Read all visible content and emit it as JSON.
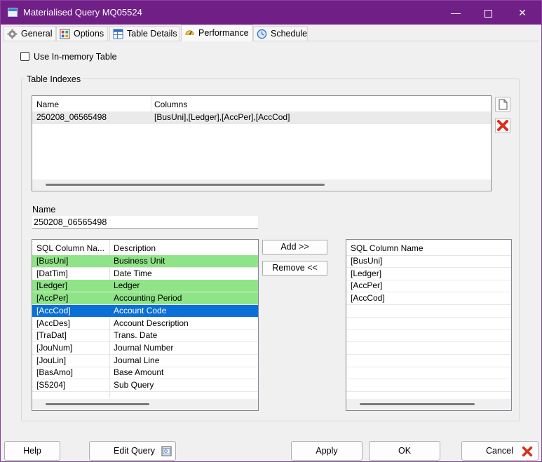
{
  "window": {
    "title": "Materialised Query MQ05524",
    "minimize": "—",
    "maximize": "☐",
    "close": "✕"
  },
  "tabs": [
    {
      "label": "General",
      "icon": "gear-icon"
    },
    {
      "label": "Options",
      "icon": "options-icon"
    },
    {
      "label": "Table Details",
      "icon": "table-icon"
    },
    {
      "label": "Performance",
      "icon": "performance-icon",
      "active": true
    },
    {
      "label": "Schedule",
      "icon": "clock-icon"
    }
  ],
  "performance": {
    "in_memory_label": "Use In-memory Table",
    "in_memory_checked": false,
    "group_title": "Table Indexes",
    "indexes": {
      "columns": [
        "Name",
        "Columns"
      ],
      "rows": [
        {
          "name": "250208_06565498",
          "columns": "[BusUni],[Ledger],[AccPer],[AccCod]"
        }
      ]
    },
    "name_label": "Name",
    "name_value": "250208_06565498",
    "available": {
      "columns": [
        "SQL Column Na...",
        "Description"
      ],
      "rows": [
        {
          "col": "[BusUni]",
          "desc": "Business Unit",
          "state": "added"
        },
        {
          "col": "[DatTim]",
          "desc": "Date Time",
          "state": ""
        },
        {
          "col": "[Ledger]",
          "desc": "Ledger",
          "state": "added"
        },
        {
          "col": "[AccPer]",
          "desc": "Accounting Period",
          "state": "added"
        },
        {
          "col": "[AccCod]",
          "desc": "Account Code",
          "state": "selected"
        },
        {
          "col": "[AccDes]",
          "desc": "Account Description",
          "state": ""
        },
        {
          "col": "[TraDat]",
          "desc": "Trans. Date",
          "state": ""
        },
        {
          "col": "[JouNum]",
          "desc": "Journal Number",
          "state": ""
        },
        {
          "col": "[JouLin]",
          "desc": "Journal Line",
          "state": ""
        },
        {
          "col": "[BasAmo]",
          "desc": "Base Amount",
          "state": ""
        },
        {
          "col": "[S5204]",
          "desc": "Sub Query",
          "state": ""
        }
      ]
    },
    "add_label": "Add >>",
    "remove_label": "Remove <<",
    "selected": {
      "column": "SQL Column Name",
      "rows": [
        "[BusUni]",
        "[Ledger]",
        "[AccPer]",
        "[AccCod]"
      ]
    }
  },
  "footer": {
    "help": "Help",
    "edit_query": "Edit Query",
    "apply": "Apply",
    "ok": "OK",
    "cancel": "Cancel"
  },
  "colors": {
    "titlebar": "#6f1f86",
    "added_row": "#8ee486",
    "selected_row": "#0a6fd6",
    "delete_red": "#d9301c"
  }
}
